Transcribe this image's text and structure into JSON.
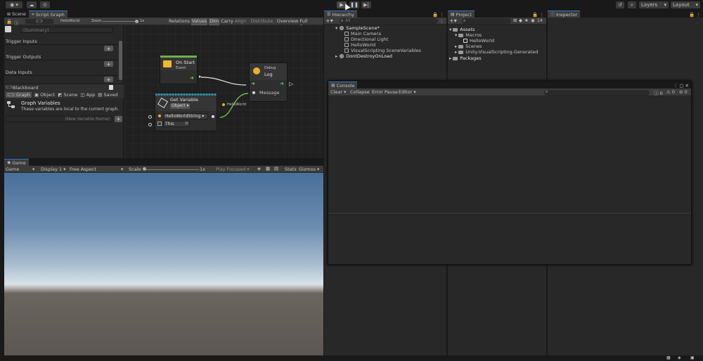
{
  "toolbar": {
    "layers_label": "Layers",
    "layout_label": "Layout"
  },
  "scene_tabs": {
    "scene": "Scene",
    "script_graph": "Script Graph"
  },
  "graph_toolbar": {
    "graph_name": "HelloWorld",
    "zoom_label": "Zoom",
    "zoom_value": "1x",
    "buttons": [
      "Relations",
      "Values",
      "Dim",
      "Carry",
      "Align ▾",
      "Distribute ▾",
      "Overview",
      "Full Screen"
    ]
  },
  "graph_inspector": {
    "summary_placeholder": "(Summary)",
    "trigger_inputs": "Trigger Inputs",
    "trigger_outputs": "Trigger Outputs",
    "data_inputs": "Data Inputs"
  },
  "blackboard": {
    "title": "Blackboard",
    "tabs": [
      "Graph",
      "Object",
      "Scene",
      "App",
      "Saved"
    ],
    "graph_variables_title": "Graph Variables",
    "graph_variables_desc": "These variables are local to the current graph.",
    "new_variable_placeholder": "(New Variable Name)"
  },
  "nodes": {
    "on_start": {
      "title": "On Start",
      "subtitle": "Event"
    },
    "debug_log": {
      "category": "Debug",
      "title": "Log",
      "port_label": "Message"
    },
    "get_variable": {
      "title": "Get Variable",
      "kind": "Object",
      "name_value": "HelloWorldString",
      "target": "This"
    },
    "connection_label": "HelloWorld"
  },
  "game": {
    "tab": "Game",
    "mode": "Game",
    "display": "Display 1",
    "aspect": "Free Aspect",
    "scale_label": "Scale",
    "scale_value": "1x",
    "play_focused": "Play Focused",
    "stats": "Stats",
    "gizmos": "Gizmos"
  },
  "hierarchy": {
    "tab": "Hierarchy",
    "search_placeholder": "All",
    "scene": "SampleScene*",
    "items": [
      "Main Camera",
      "Directional Light",
      "HelloWorld",
      "VisualScripting SceneVariables"
    ],
    "dont_destroy": "DontDestroyOnLoad"
  },
  "project": {
    "tab": "Project",
    "count": "14",
    "assets": "Assets",
    "macros": "Macros",
    "helloworld": "HelloWorld",
    "scenes": "Scenes",
    "generated": "Unity.VisualScripting.Generated",
    "packages": "Packages"
  },
  "inspector": {
    "tab": "Inspector"
  },
  "console": {
    "tab": "Console",
    "clear": "Clear",
    "collapse": "Collapse",
    "error_pause": "Error Pause",
    "editor": "Editor",
    "log_count": "0",
    "warn_count": "0",
    "error_count": "0"
  },
  "colors": {
    "accent": "#3a79bb",
    "event_green": "#6fb14a",
    "port_green": "#7ed24f",
    "sky_top": "#4a6f9b",
    "ground": "#5d5753"
  }
}
